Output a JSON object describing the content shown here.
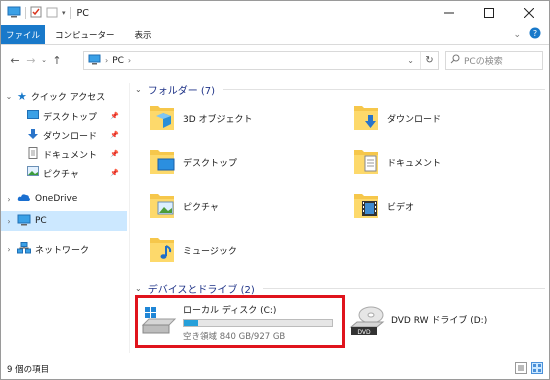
{
  "window": {
    "title": "PC"
  },
  "ribbon": {
    "tabs": [
      "ファイル",
      "コンピューター",
      "表示"
    ]
  },
  "address": {
    "path": [
      "PC"
    ]
  },
  "search": {
    "placeholder": "PCの検索"
  },
  "nav": {
    "quick_access": "クイック アクセス",
    "quick_items": [
      "デスクトップ",
      "ダウンロード",
      "ドキュメント",
      "ピクチャ"
    ],
    "onedrive": "OneDrive",
    "pc": "PC",
    "network": "ネットワーク"
  },
  "folders": {
    "header": "フォルダー (7)",
    "items": [
      "3D オブジェクト",
      "ダウンロード",
      "デスクトップ",
      "ドキュメント",
      "ピクチャ",
      "ビデオ",
      "ミュージック"
    ]
  },
  "devices": {
    "header": "デバイスとドライブ (2)",
    "drives": [
      {
        "name": "ローカル ディスク (C:)",
        "free_text": "空き領域 840 GB/927 GB",
        "used_fraction": 0.094
      },
      {
        "name": "DVD RW ドライブ (D:)"
      }
    ]
  },
  "status": {
    "count": "9 個の項目"
  },
  "colors": {
    "accent": "#1979ca",
    "selection": "#cce8ff",
    "highlight_box": "#e0141d",
    "folder": "#f6c74b"
  }
}
